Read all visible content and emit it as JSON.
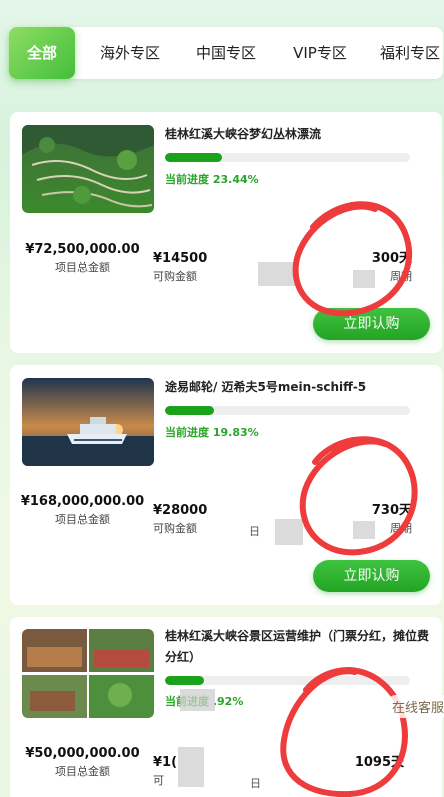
{
  "tabs": [
    {
      "label": "全部"
    },
    {
      "label": "海外专区"
    },
    {
      "label": "中国专区"
    },
    {
      "label": "VIP专区"
    },
    {
      "label": "福利专区"
    }
  ],
  "labels": {
    "total": "项目总金额",
    "available": "可购金额",
    "period": "周期",
    "buy": "立即认购",
    "progress_prefix": "当前进度"
  },
  "products": [
    {
      "title": "桂林红溪大峡谷梦幻丛林漂流",
      "progress_text": "当前进度 23.44%",
      "progress": 23.44,
      "total": "¥72,500,000.00",
      "available": "¥14500",
      "period": "300天",
      "buy_label": "立即认购"
    },
    {
      "title": "途易邮轮/ 迈希夫5号mein-schiff-5",
      "progress_text": "当前进度 19.83%",
      "progress": 19.83,
      "total": "¥168,000,000.00",
      "available": "¥28000",
      "period": "730天",
      "buy_label": "立即认购"
    },
    {
      "title": "桂林红溪大峡谷景区运营维护（门票分红，摊位费分红）",
      "progress_text": "当前进度 .92%",
      "progress": 16,
      "total": "¥50,000,000.00",
      "available": "¥1(",
      "period": "1095天"
    }
  ],
  "overlay": {
    "customer_service": "在线客服",
    "unit_fragment": "日",
    "avail_fragment": "可"
  },
  "colors": {
    "accent": "#1aa31a",
    "annotation": "#ee3b3b"
  }
}
